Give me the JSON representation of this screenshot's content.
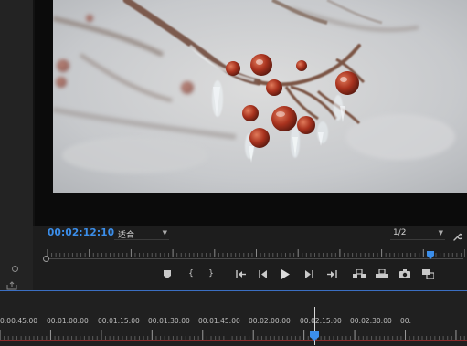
{
  "monitor": {
    "timecode": "00:02:12:10",
    "fit_value": "适合",
    "resolution_value": "1/2",
    "playhead_position": 0.93
  },
  "transport": {
    "buttons": [
      {
        "name": "add-marker-button",
        "icon": "marker-icon"
      },
      {
        "name": "mark-in-button",
        "icon": "mark-in-icon",
        "glyph": "{"
      },
      {
        "name": "mark-out-button",
        "icon": "mark-out-icon",
        "glyph": "}"
      },
      {
        "name": "go-to-in-button",
        "icon": "go-to-in-icon"
      },
      {
        "name": "step-back-button",
        "icon": "step-back-icon"
      },
      {
        "name": "play-button",
        "icon": "play-icon"
      },
      {
        "name": "step-forward-button",
        "icon": "step-forward-icon"
      },
      {
        "name": "go-to-out-button",
        "icon": "go-to-out-icon"
      },
      {
        "name": "insert-button",
        "icon": "insert-icon"
      },
      {
        "name": "overwrite-button",
        "icon": "overwrite-icon"
      },
      {
        "name": "export-frame-button",
        "icon": "camera-icon"
      },
      {
        "name": "button-editor-button",
        "icon": "button-editor-icon"
      }
    ]
  },
  "timeline": {
    "ruler_labels": [
      "0:00:45:00",
      "00:01:00:00",
      "00:01:15:00",
      "00:01:30:00",
      "00:01:45:00",
      "00:02:00:00",
      "00:02:15:00",
      "00:02:30:00",
      "00:"
    ],
    "playhead_time": "00:02:12:10"
  },
  "colors": {
    "timecode": "#3b8eea",
    "playhead": "#3b8eea",
    "panel_focus_border": "#3b6fc2",
    "work_area_bar": "#8c2a2a"
  }
}
